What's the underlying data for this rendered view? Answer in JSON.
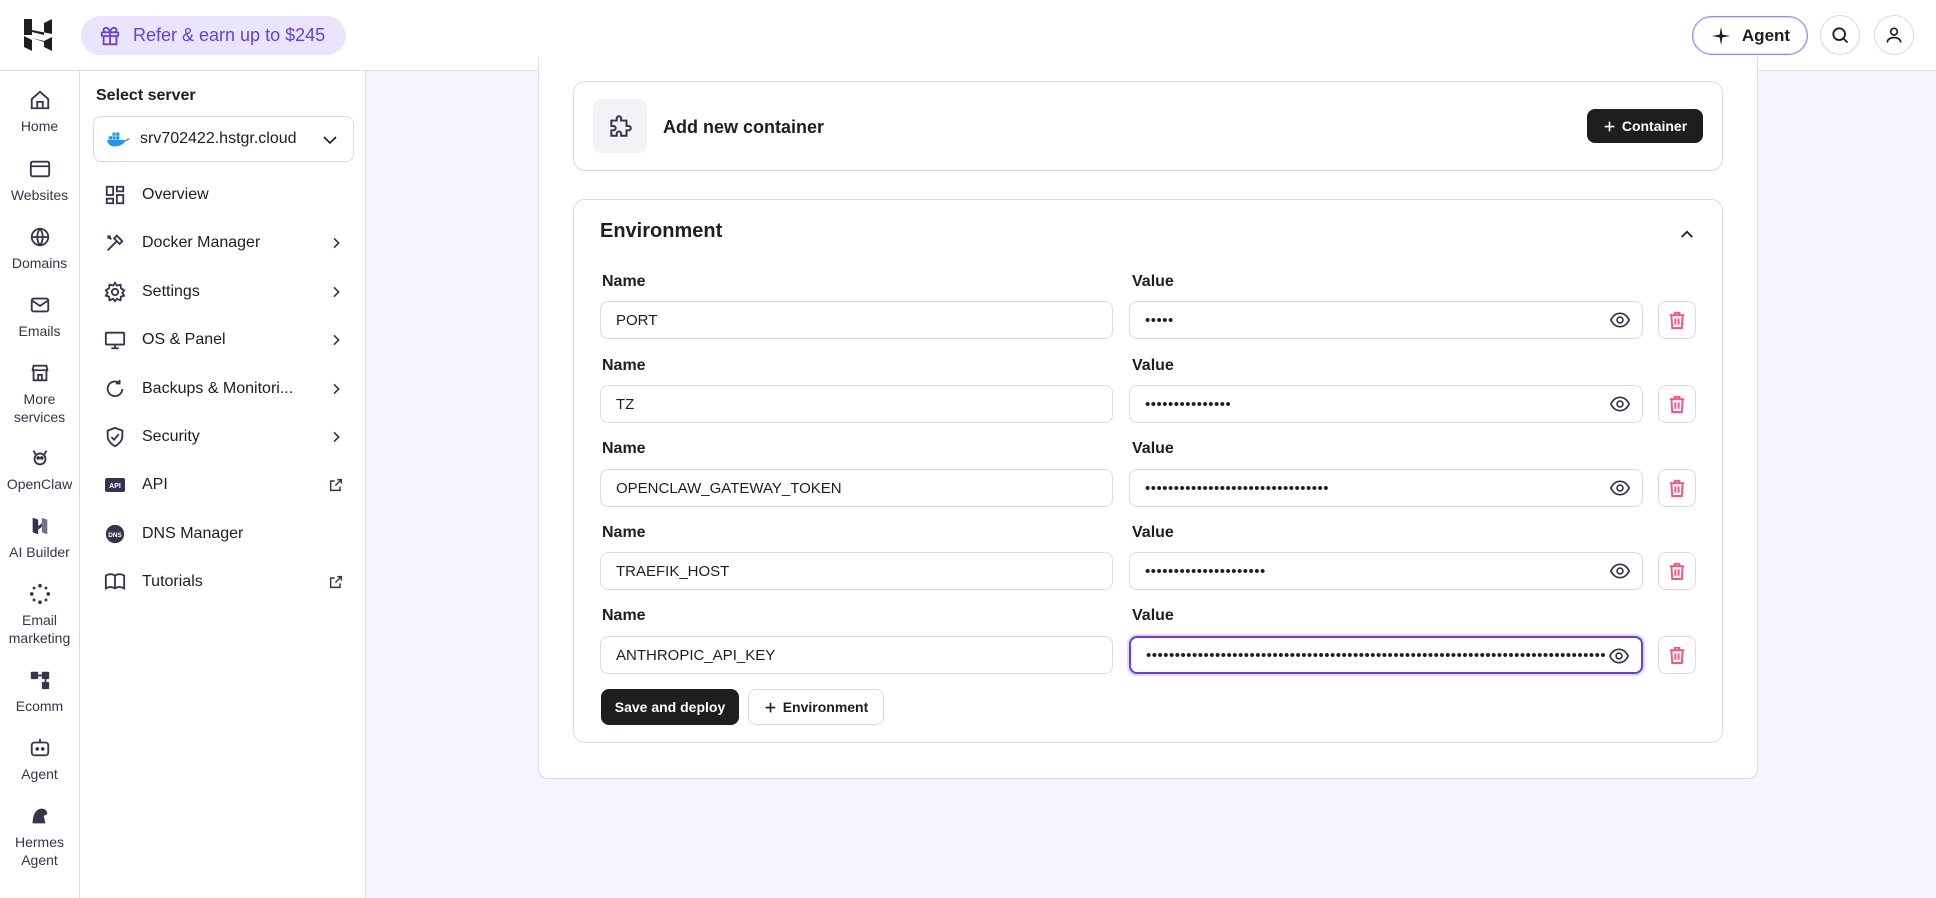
{
  "topbar": {
    "refer_label": "Refer & earn up to $245",
    "agent_label": "Agent"
  },
  "rail": {
    "items": [
      {
        "label": "Home",
        "icon": "home-icon"
      },
      {
        "label": "Websites",
        "icon": "websites-icon"
      },
      {
        "label": "Domains",
        "icon": "globe-icon"
      },
      {
        "label": "Emails",
        "icon": "mail-icon"
      },
      {
        "label": "More services",
        "icon": "store-icon"
      },
      {
        "label": "OpenClaw",
        "icon": "openclaw-icon"
      },
      {
        "label": "AI Builder",
        "icon": "ai-builder-icon"
      },
      {
        "label": "Email marketing",
        "icon": "email-marketing-icon"
      },
      {
        "label": "Ecomm",
        "icon": "ecomm-icon"
      },
      {
        "label": "Agent",
        "icon": "agent-icon"
      },
      {
        "label": "Hermes Agent",
        "icon": "hermes-icon"
      }
    ]
  },
  "sidebar": {
    "select_label": "Select server",
    "server": "srv702422.hstgr.cloud",
    "items": [
      {
        "label": "Overview",
        "icon": "overview-icon",
        "trailing": "none"
      },
      {
        "label": "Docker Manager",
        "icon": "docker-manager-icon",
        "trailing": "chevron"
      },
      {
        "label": "Settings",
        "icon": "gear-icon",
        "trailing": "chevron"
      },
      {
        "label": "OS & Panel",
        "icon": "monitor-icon",
        "trailing": "chevron"
      },
      {
        "label": "Backups & Monitori...",
        "icon": "backup-icon",
        "trailing": "chevron"
      },
      {
        "label": "Security",
        "icon": "shield-icon",
        "trailing": "chevron"
      },
      {
        "label": "API",
        "icon": "api-icon",
        "trailing": "external"
      },
      {
        "label": "DNS Manager",
        "icon": "dns-icon",
        "trailing": "none"
      },
      {
        "label": "Tutorials",
        "icon": "book-icon",
        "trailing": "external"
      }
    ]
  },
  "container_card": {
    "title": "Add new container",
    "button_label": "Container"
  },
  "environment": {
    "title": "Environment",
    "name_label": "Name",
    "value_label": "Value",
    "rows": [
      {
        "name": "PORT",
        "value": "•••••"
      },
      {
        "name": "TZ",
        "value": "•••••••••••••••"
      },
      {
        "name": "OPENCLAW_GATEWAY_TOKEN",
        "value": "••••••••••••••••••••••••••••••••"
      },
      {
        "name": "TRAEFIK_HOST",
        "value": "•••••••••••••••••••••"
      },
      {
        "name": "ANTHROPIC_API_KEY",
        "value": "•••••••••••••••••••••••••••••••••••••••••••••••••••••••••••••••••••••••••••••••••••••"
      }
    ],
    "save_label": "Save and deploy",
    "add_label": "Environment"
  },
  "colors": {
    "accent": "#673de6",
    "danger": "#fc5185",
    "dark": "#1d1e20"
  }
}
